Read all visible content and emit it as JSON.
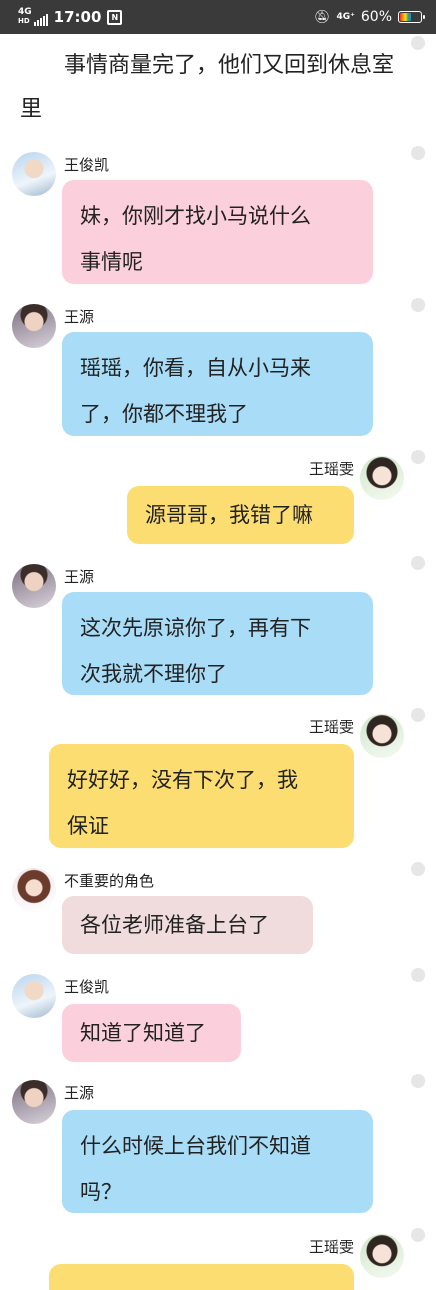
{
  "status_bar": {
    "network_left": "4G",
    "network_left_hd": "HD",
    "time": "17:00",
    "notification_badge": "N",
    "mute_icon": "mute-icon",
    "network_right": "4G⁺",
    "battery_percent": "60%",
    "battery_level": 0.6
  },
  "narration": {
    "text": "事情商量完了，他们又回到休息室里"
  },
  "messages": [
    {
      "speaker": "王俊凯",
      "side": "left",
      "color": "pink",
      "lines": [
        "妹，你刚才找小马说什么",
        "事情呢"
      ]
    },
    {
      "speaker": "王源",
      "side": "left",
      "color": "blue",
      "lines": [
        "瑶瑶，你看，自从小马来",
        "了，你都不理我了"
      ]
    },
    {
      "speaker": "王瑶雯",
      "side": "right",
      "color": "yellow",
      "lines": [
        "源哥哥，我错了嘛"
      ]
    },
    {
      "speaker": "王源",
      "side": "left",
      "color": "blue",
      "lines": [
        "这次先原谅你了，再有下",
        "次我就不理你了"
      ]
    },
    {
      "speaker": "王瑶雯",
      "side": "right",
      "color": "yellow",
      "lines": [
        "好好好，没有下次了，我",
        "保证"
      ]
    },
    {
      "speaker": "不重要的角色",
      "side": "left",
      "color": "grey",
      "lines": [
        "各位老师准备上台了"
      ]
    },
    {
      "speaker": "王俊凯",
      "side": "left",
      "color": "pink",
      "lines": [
        "知道了知道了"
      ]
    },
    {
      "speaker": "王源",
      "side": "left",
      "color": "blue",
      "lines": [
        "什么时候上台我们不知道",
        "吗？"
      ]
    },
    {
      "speaker": "王瑶雯",
      "side": "right",
      "color": "yellow",
      "lines": [
        ""
      ]
    }
  ]
}
